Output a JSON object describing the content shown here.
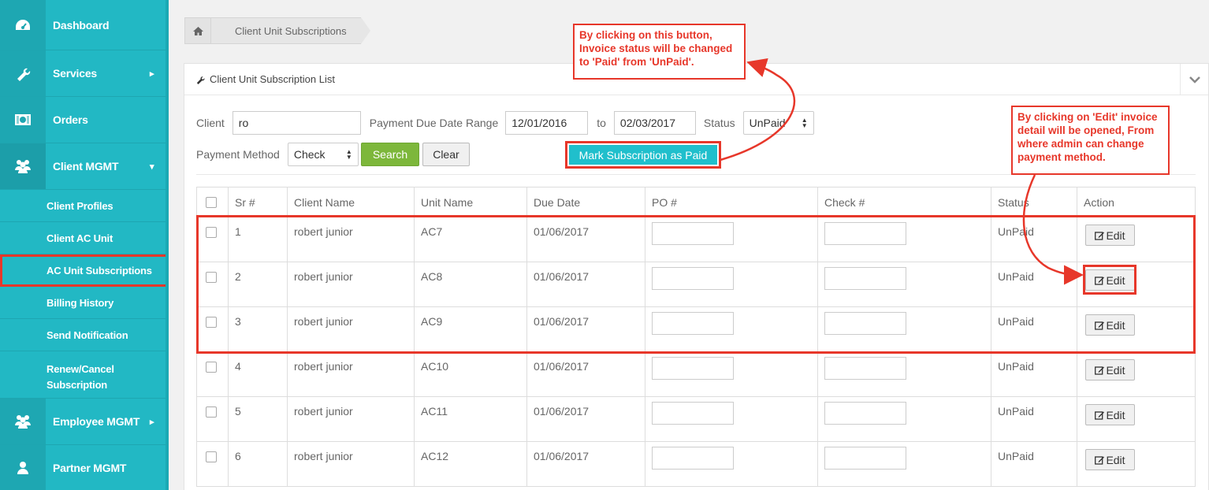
{
  "sidebar": {
    "items": [
      {
        "label": "Dashboard",
        "icon": "dashboard-icon"
      },
      {
        "label": "Services",
        "icon": "wrench-icon"
      },
      {
        "label": "Orders",
        "icon": "money-icon"
      },
      {
        "label": "Client MGMT",
        "icon": "users-icon"
      }
    ],
    "sub_items": [
      "Client Profiles",
      "Client AC Unit",
      "AC Unit Subscriptions",
      "Billing History",
      "Send Notification",
      "Renew/Cancel Subscription"
    ],
    "bottom_items": [
      {
        "label": "Employee MGMT",
        "icon": "users-icon"
      },
      {
        "label": "Partner MGMT",
        "icon": "user-icon"
      }
    ]
  },
  "breadcrumb": {
    "current": "Client Unit Subscriptions"
  },
  "panel": {
    "title": "Client Unit Subscription List"
  },
  "filters": {
    "client_label": "Client",
    "client_value": "ro",
    "range_label": "Payment Due Date Range",
    "from_value": "12/01/2016",
    "to_label": "to",
    "to_value": "02/03/2017",
    "status_label": "Status",
    "status_value": "UnPaid",
    "payment_label": "Payment Method",
    "payment_value": "Check",
    "search_label": "Search",
    "clear_label": "Clear",
    "mark_label": "Mark Subscription as Paid"
  },
  "table": {
    "headers": [
      "Sr #",
      "Client Name",
      "Unit Name",
      "Due Date",
      "PO #",
      "Check #",
      "Status",
      "Action"
    ],
    "rows": [
      {
        "sr": "1",
        "client": "robert junior",
        "unit": "AC7",
        "due": "01/06/2017",
        "status": "UnPaid",
        "action": "Edit"
      },
      {
        "sr": "2",
        "client": "robert junior",
        "unit": "AC8",
        "due": "01/06/2017",
        "status": "UnPaid",
        "action": "Edit"
      },
      {
        "sr": "3",
        "client": "robert junior",
        "unit": "AC9",
        "due": "01/06/2017",
        "status": "UnPaid",
        "action": "Edit"
      },
      {
        "sr": "4",
        "client": "robert junior",
        "unit": "AC10",
        "due": "01/06/2017",
        "status": "UnPaid",
        "action": "Edit"
      },
      {
        "sr": "5",
        "client": "robert junior",
        "unit": "AC11",
        "due": "01/06/2017",
        "status": "UnPaid",
        "action": "Edit"
      },
      {
        "sr": "6",
        "client": "robert junior",
        "unit": "AC12",
        "due": "01/06/2017",
        "status": "UnPaid",
        "action": "Edit"
      }
    ]
  },
  "annotations": {
    "mark_note": [
      "By clicking on this button,",
      "Invoice status will be changed",
      "to 'Paid' from 'UnPaid'."
    ],
    "edit_note": [
      "By clicking on 'Edit' invoice",
      "detail will be opened, From",
      "where admin can change",
      "payment method."
    ]
  },
  "colors": {
    "sidebar": "#22b8c4",
    "annotation": "#e7372a",
    "search": "#7db73b",
    "mark": "#20bfcc"
  }
}
